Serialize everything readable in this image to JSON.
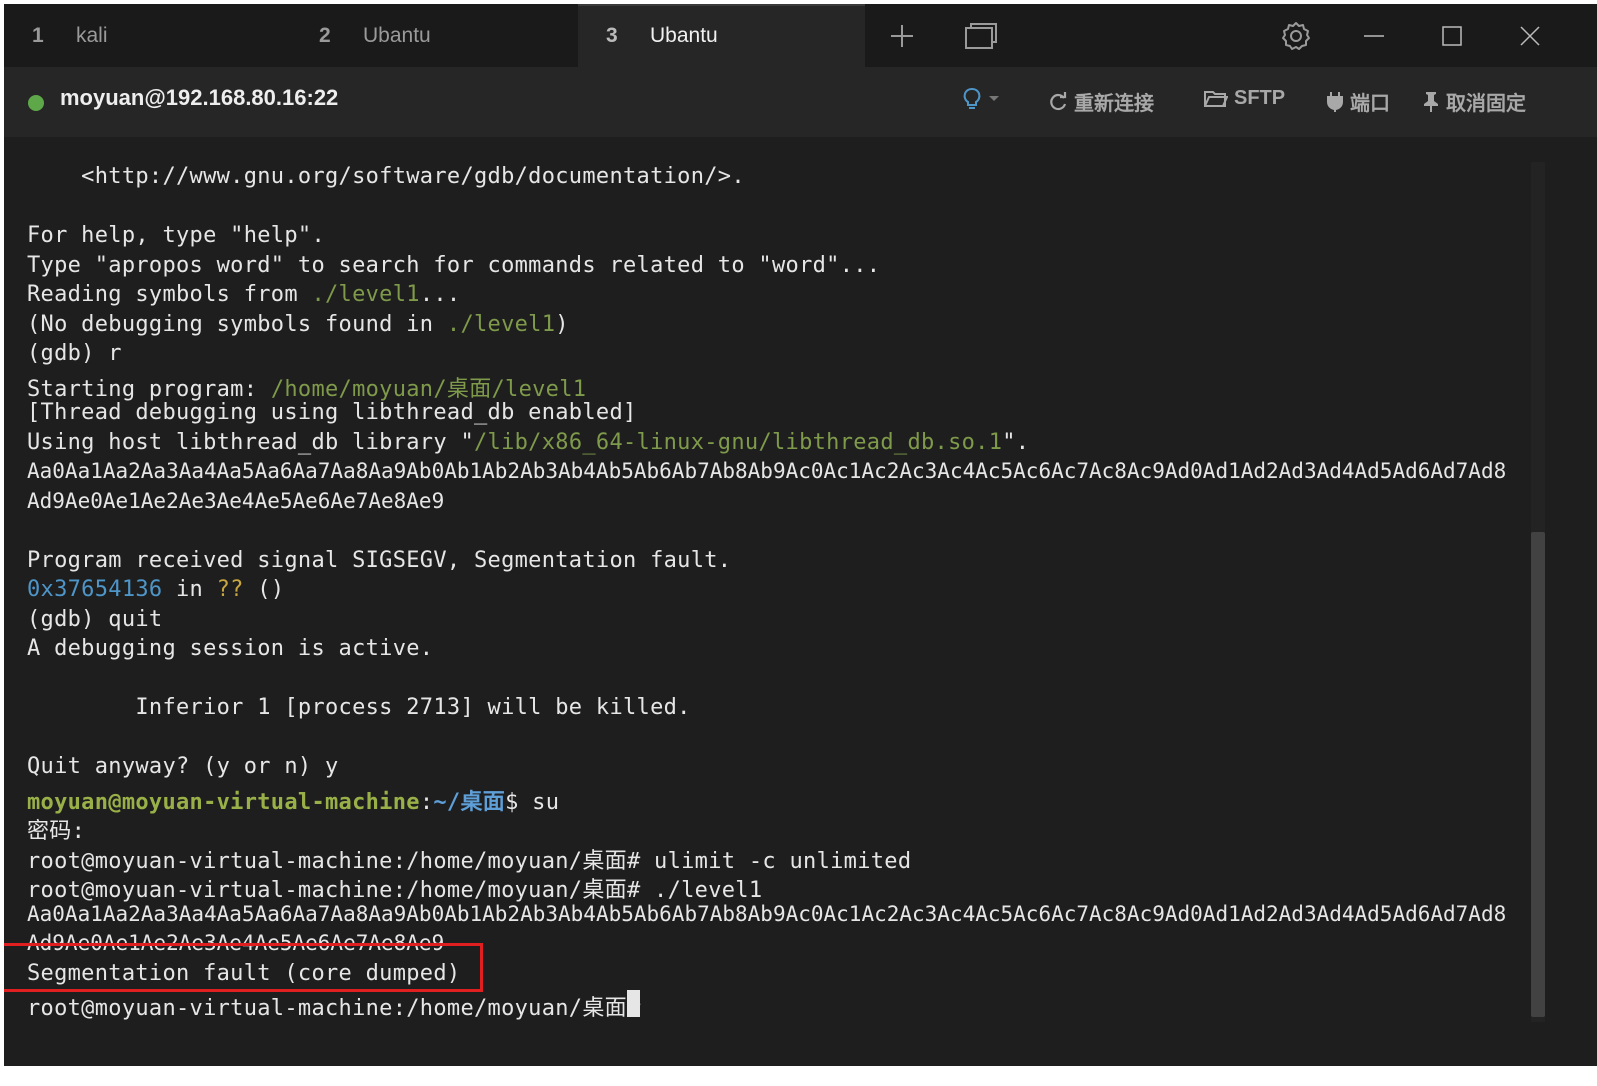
{
  "tabs": [
    {
      "num": "1",
      "label": "kali"
    },
    {
      "num": "2",
      "label": "Ubantu"
    },
    {
      "num": "3",
      "label": "Ubantu"
    }
  ],
  "header": {
    "host": "moyuan@192.168.80.16:22",
    "reconnect": "重新连接",
    "sftp": "SFTP",
    "port": "端口",
    "unpin": "取消固定"
  },
  "terminal": {
    "l1": "    <http://www.gnu.org/software/gdb/documentation/>.",
    "l2": "For help, type \"help\".",
    "l3": "Type \"apropos word\" to search for commands related to \"word\"...",
    "l4a": "Reading symbols from ",
    "l4b": "./level1",
    "l4c": "...",
    "l5a": "(No debugging symbols found in ",
    "l5b": "./level1",
    "l5c": ")",
    "l6": "(gdb) r",
    "l7a": "Starting program: ",
    "l7b": "/home/moyuan/桌面/level1",
    "l8": "[Thread debugging using libthread_db enabled]",
    "l9a": "Using host libthread_db library \"",
    "l9b": "/lib/x86_64-linux-gnu/libthread_db.so.1",
    "l9c": "\".",
    "l10": "Aa0Aa1Aa2Aa3Aa4Aa5Aa6Aa7Aa8Aa9Ab0Ab1Ab2Ab3Ab4Ab5Ab6Ab7Ab8Ab9Ac0Ac1Ac2Ac3Ac4Ac5Ac6Ac7Ac8Ac9Ad0Ad1Ad2Ad3Ad4Ad5Ad6Ad7Ad8",
    "l11": "Ad9Ae0Ae1Ae2Ae3Ae4Ae5Ae6Ae7Ae8Ae9",
    "l12": "Program received signal SIGSEGV, Segmentation fault.",
    "l13a": "0x37654136",
    "l13b": " in ",
    "l13c": "??",
    "l13d": " ()",
    "l14": "(gdb) quit",
    "l15": "A debugging session is active.",
    "l16": "        Inferior 1 [process 2713] will be killed.",
    "l17": "Quit anyway? (y or n) y",
    "l18a": "moyuan@moyuan-virtual-machine",
    "l18b": ":",
    "l18c": "~/桌面",
    "l18d": "$ su",
    "l19": "密码:",
    "l20": "root@moyuan-virtual-machine:/home/moyuan/桌面# ulimit -c unlimited",
    "l21": "root@moyuan-virtual-machine:/home/moyuan/桌面# ./level1",
    "l22": "Aa0Aa1Aa2Aa3Aa4Aa5Aa6Aa7Aa8Aa9Ab0Ab1Ab2Ab3Ab4Ab5Ab6Ab7Ab8Ab9Ac0Ac1Ac2Ac3Ac4Ac5Ac6Ac7Ac8Ac9Ad0Ad1Ad2Ad3Ad4Ad5Ad6Ad7Ad8",
    "l23": "Ad9Ae0Ae1Ae2Ae3Ae4Ae5Ae6Ae7Ae8Ae9",
    "l24": "Segmentation fault (core dumped)",
    "l25": "root@moyuan-virtual-machine:/home/moyuan/桌面# "
  },
  "colors": {
    "accent_green": "#5fa84a",
    "highlight_box": "#e02020"
  }
}
